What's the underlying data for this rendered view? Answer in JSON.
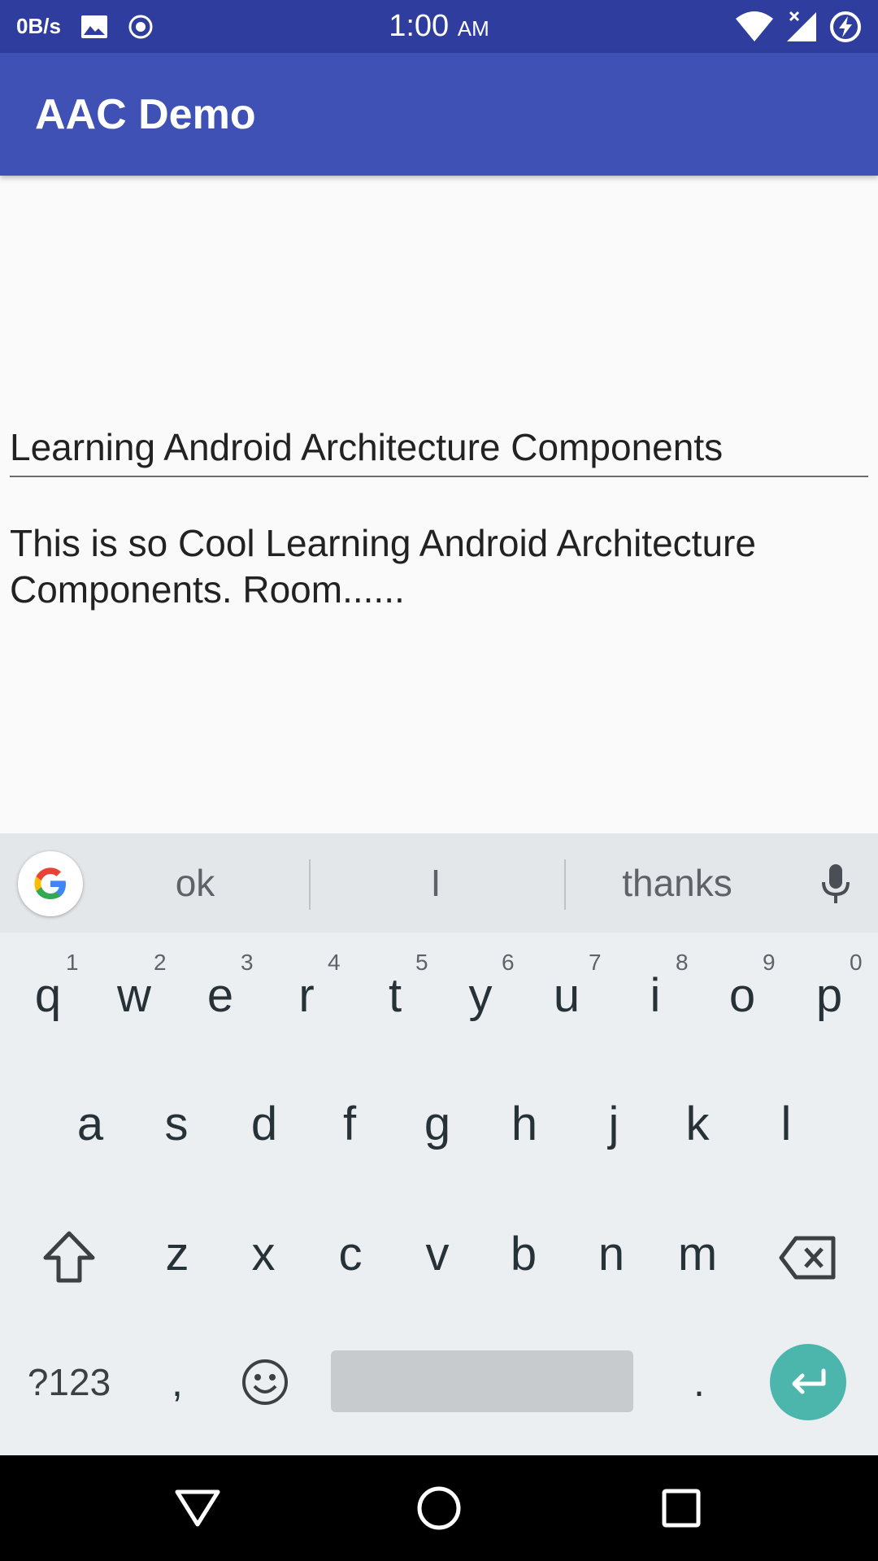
{
  "status_bar": {
    "net_speed": "0B/s",
    "time": "1:00",
    "ampm": "AM"
  },
  "app_bar": {
    "title": "AAC Demo"
  },
  "content": {
    "title_value": "Learning Android Architecture Components",
    "body_value": "This is so Cool Learning Android Architecture Components. Room......"
  },
  "keyboard": {
    "suggestions": [
      "ok",
      "I",
      "thanks"
    ],
    "row1": [
      {
        "key": "q",
        "hint": "1"
      },
      {
        "key": "w",
        "hint": "2"
      },
      {
        "key": "e",
        "hint": "3"
      },
      {
        "key": "r",
        "hint": "4"
      },
      {
        "key": "t",
        "hint": "5"
      },
      {
        "key": "y",
        "hint": "6"
      },
      {
        "key": "u",
        "hint": "7"
      },
      {
        "key": "i",
        "hint": "8"
      },
      {
        "key": "o",
        "hint": "9"
      },
      {
        "key": "p",
        "hint": "0"
      }
    ],
    "row2": [
      "a",
      "s",
      "d",
      "f",
      "g",
      "h",
      "j",
      "k",
      "l"
    ],
    "row3": [
      "z",
      "x",
      "c",
      "v",
      "b",
      "n",
      "m"
    ],
    "symbols_label": "?123",
    "comma_label": ",",
    "period_label": "."
  },
  "colors": {
    "status_bar": "#2f3e9e",
    "app_bar": "#3f51b5",
    "enter_key": "#4db6ac"
  }
}
